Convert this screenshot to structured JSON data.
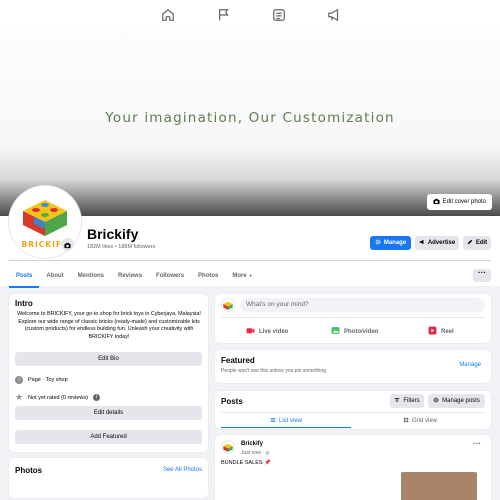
{
  "nav": {
    "items": [
      {
        "name": "home-icon"
      },
      {
        "name": "flag-icon"
      },
      {
        "name": "marketplace-icon"
      },
      {
        "name": "megaphone-icon"
      }
    ]
  },
  "cover": {
    "tagline": "Your imagination, Our Customization",
    "edit_cover_label": "Edit cover photo"
  },
  "profile": {
    "logo_text": "BRICKIFY",
    "name": "Brickify",
    "stats": "182M likes • 188M followers",
    "manage_label": "Manage",
    "advertise_label": "Advertise",
    "edit_label": "Edit"
  },
  "tabs": [
    {
      "label": "Posts"
    },
    {
      "label": "About"
    },
    {
      "label": "Mentions"
    },
    {
      "label": "Reviews"
    },
    {
      "label": "Followers"
    },
    {
      "label": "Photos"
    },
    {
      "label": "More"
    }
  ],
  "more_dots": "···",
  "intro": {
    "title": "Intro",
    "bio": "Welcome to BRICKIFY, your go-to shop for brick toys in Cyberjaya, Malaysia! Explore our wide range of classic bricks (ready-made) and customizable kits (custom products) for endless building fun. Unleash your creativity with BRICKIFY today!",
    "edit_bio_label": "Edit Bio",
    "page_type": "Page · Toy shop",
    "rating": "Not yet rated (0 reviews)",
    "edit_details_label": "Edit details",
    "add_featured_label": "Add Featured"
  },
  "photos": {
    "title": "Photos",
    "see_all_label": "See All Photos"
  },
  "composer": {
    "placeholder": "What's on your mind?",
    "live_label": "Live video",
    "photo_label": "Photo/video",
    "reel_label": "Reel"
  },
  "featured": {
    "title": "Featured",
    "subtitle": "People won't see this unless you pin something.",
    "manage_label": "Manage"
  },
  "posts": {
    "title": "Posts",
    "filters_label": "Filters",
    "manage_posts_label": "Manage posts",
    "list_view_label": "List view",
    "grid_view_label": "Grid view"
  },
  "post": {
    "author": "Brickify",
    "time": "Just now · ",
    "text": "BUNDLE SALES 📌",
    "dots": "···"
  },
  "colors": {
    "accent": "#1877f2",
    "tagline": "#5f7d52",
    "live": "#f02849",
    "photo": "#45bd62",
    "reel": "#e42645"
  }
}
